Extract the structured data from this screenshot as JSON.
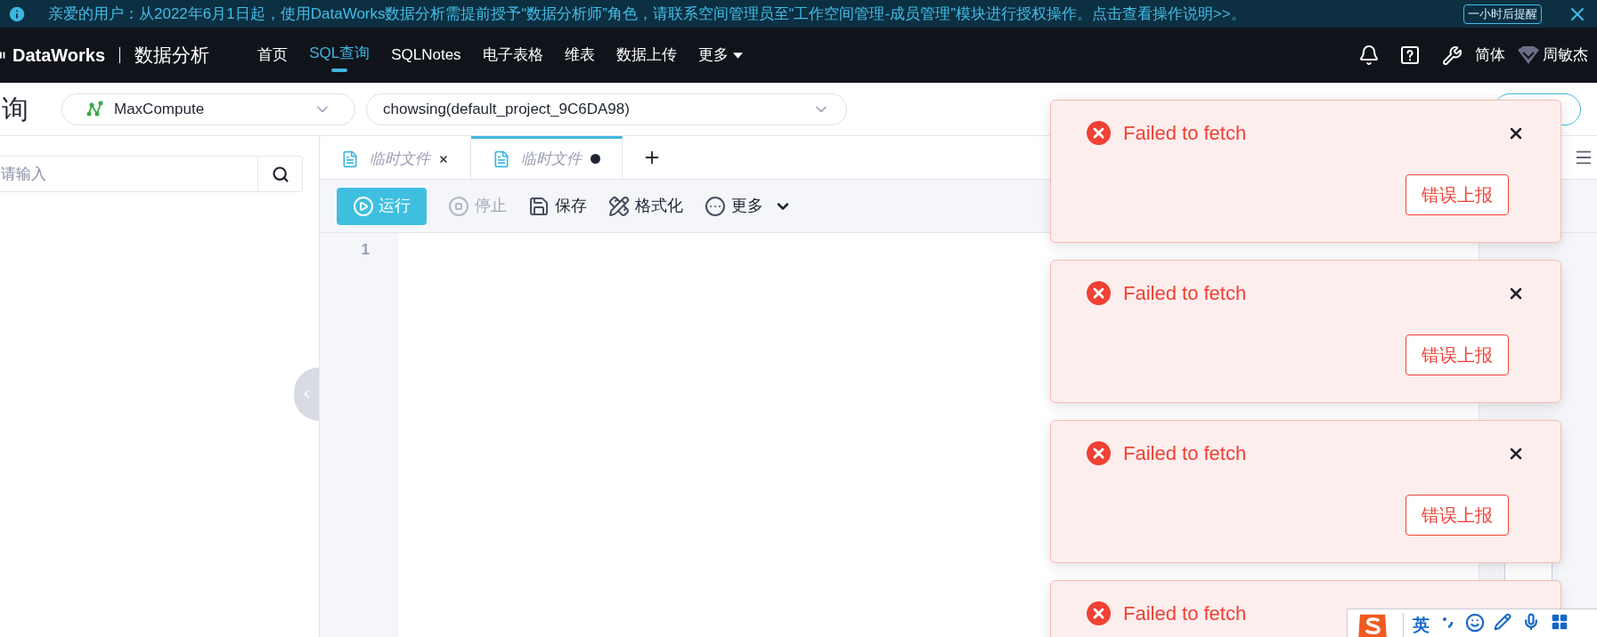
{
  "banner": {
    "message": "亲爱的用户：从2022年6月1日起，使用DataWorks数据分析需提前授予“数据分析师”角色，请联系空间管理员至“工作空间管理-成员管理”模块进行授权操作。点击查看操作说明>>。",
    "remind_button": "一小时后提醒"
  },
  "nav": {
    "logo": "DataWorks",
    "product": "数据分析",
    "items": [
      {
        "label": "首页",
        "selected": false
      },
      {
        "label": "SQL查询",
        "selected": true
      },
      {
        "label": "SQLNotes",
        "selected": false
      },
      {
        "label": "电子表格",
        "selected": false
      },
      {
        "label": "维表",
        "selected": false
      },
      {
        "label": "数据上传",
        "selected": false
      },
      {
        "label": "更多",
        "selected": false
      }
    ],
    "language": "简体",
    "user": "周敏杰"
  },
  "toolbar": {
    "page_title": "询",
    "engine": "MaxCompute",
    "project": "chowsing(default_project_9C6DA98)"
  },
  "sidebar": {
    "search_placeholder": "请输入"
  },
  "tabs": [
    {
      "title": "临时文件",
      "selected": false,
      "modified": false
    },
    {
      "title": "临时文件",
      "selected": true,
      "modified": true
    }
  ],
  "actions": [
    {
      "kind": "run",
      "label": "运行",
      "disabled": false
    },
    {
      "kind": "stop",
      "label": "停止",
      "disabled": true
    },
    {
      "kind": "save",
      "label": "保存",
      "disabled": false
    },
    {
      "kind": "format",
      "label": "格式化",
      "disabled": false
    },
    {
      "kind": "more",
      "label": "更多",
      "disabled": false
    }
  ],
  "editor": {
    "line_numbers": [
      "1"
    ]
  },
  "toasts": [
    {
      "message": "Failed to fetch",
      "report_button": "错误上报"
    },
    {
      "message": "Failed to fetch",
      "report_button": "错误上报"
    },
    {
      "message": "Failed to fetch",
      "report_button": "错误上报"
    },
    {
      "message": "Failed to fetch"
    }
  ],
  "ime": {
    "mode": "英"
  }
}
